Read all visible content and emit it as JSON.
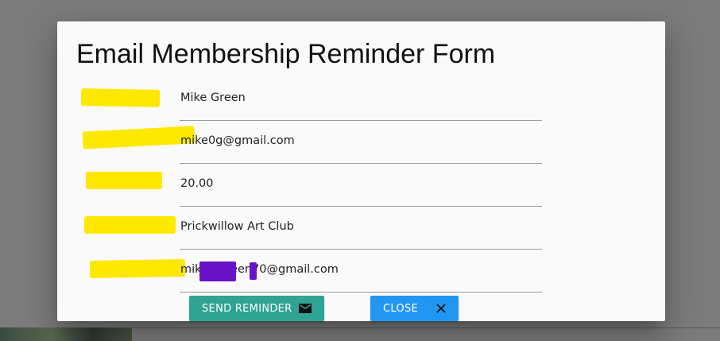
{
  "dialog": {
    "title": "Email Membership Reminder Form"
  },
  "fields": [
    {
      "value": "Mike Green"
    },
    {
      "value": "mike0g@gmail.com"
    },
    {
      "value": "20.00"
    },
    {
      "value": "Prickwillow Art Club"
    },
    {
      "value": "mikedjgreen70@gmail.com"
    }
  ],
  "actions": {
    "send_label": "SEND REMINDER",
    "send_icon": "email-icon",
    "close_label": "CLOSE",
    "close_icon": "close-icon"
  },
  "colors": {
    "send_button": "#2fa394",
    "close_button": "#2196f3",
    "redaction_yellow": "#ffe800",
    "redaction_purple": "#6a12c8"
  }
}
